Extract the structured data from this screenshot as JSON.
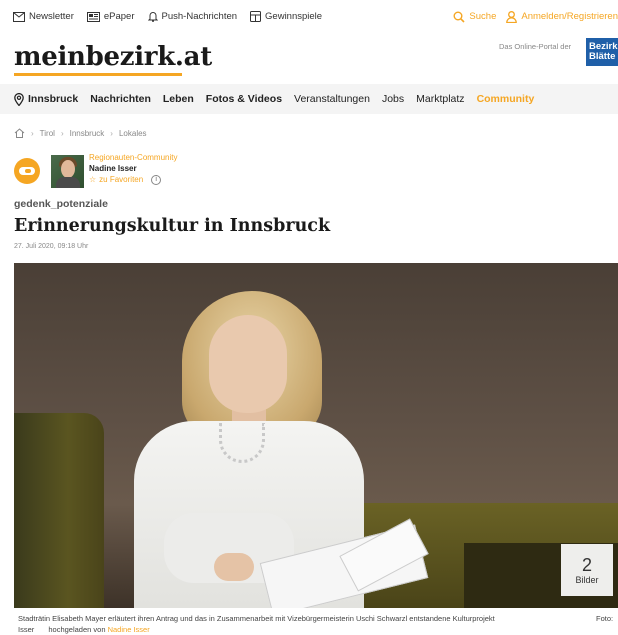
{
  "topbar": {
    "newsletter": "Newsletter",
    "epaper": "ePaper",
    "push": "Push-Nachrichten",
    "gewinnspiele": "Gewinnspiele",
    "search": "Suche",
    "login": "Anmelden/Registrieren"
  },
  "header": {
    "logo": "meinbezirk.at",
    "portal_text": "Das Online-Portal der",
    "brand_line1": "Bezirk",
    "brand_line2": "Blätte"
  },
  "nav": {
    "location": "Innsbruck",
    "items": [
      "Nachrichten",
      "Leben",
      "Fotos & Videos",
      "Veranstaltungen",
      "Jobs",
      "Marktplatz",
      "Community"
    ]
  },
  "breadcrumb": [
    "Tirol",
    "Innsbruck",
    "Lokales"
  ],
  "author": {
    "community": "Regionauten-Community",
    "name": "Nadine Isser",
    "favorite": "zu Favoriten"
  },
  "article": {
    "tag": "gedenk_potenziale",
    "title": "Erinnerungskultur in Innsbruck",
    "date": "27. Juli 2020, 09:18 Uhr"
  },
  "gallery": {
    "count": "2",
    "label": "Bilder"
  },
  "caption": {
    "text": "Stadträtin Elisabeth Mayer erläutert ihren Antrag und das in Zusammenarbeit mit Vizebürgermeisterin Uschi Schwarzl entstandene Kulturprojekt",
    "foto": "Foto:",
    "credit_cont": "Isser",
    "uploaded_by": "hochgeladen von",
    "uploader": "Nadine Isser"
  },
  "colors": {
    "accent": "#f5a623",
    "brand_blue": "#1f5fa8"
  }
}
